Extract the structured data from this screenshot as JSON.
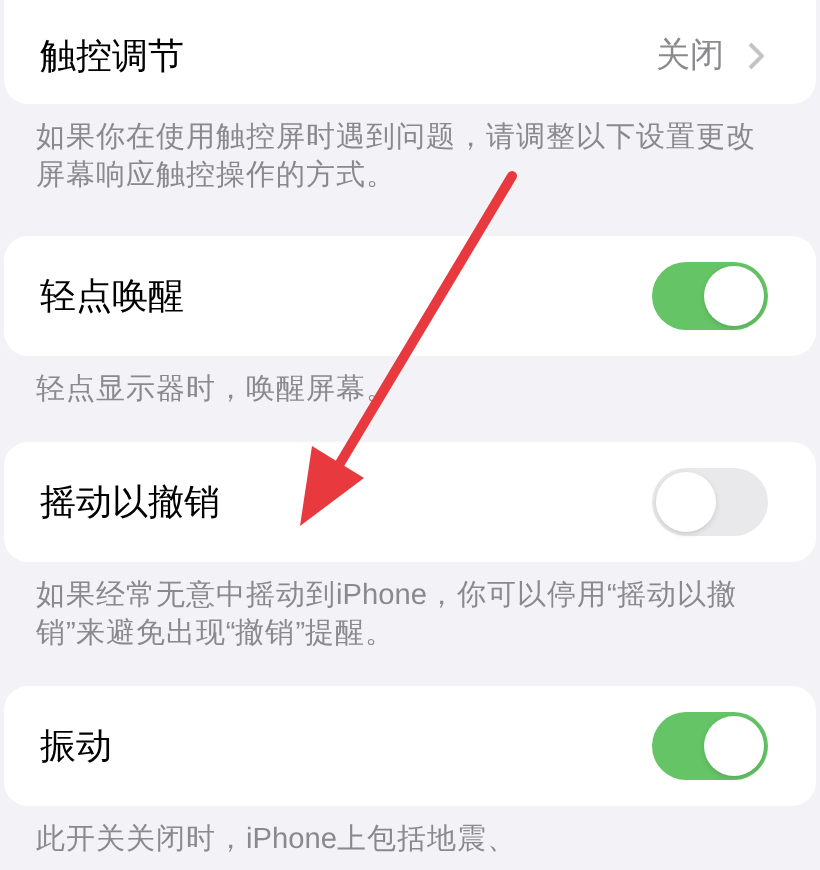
{
  "sections": [
    {
      "kind": "value",
      "label": "触控调节",
      "value": "关闭",
      "footer": "如果你在使用触控屏时遇到问题，请调整以下设置更改屏幕响应触控操作的方式。"
    },
    {
      "kind": "toggle",
      "label": "轻点唤醒",
      "on": true,
      "footer": "轻点显示器时，唤醒屏幕。"
    },
    {
      "kind": "toggle",
      "label": "摇动以撤销",
      "on": false,
      "footer": "如果经常无意中摇动到iPhone，你可以停用“摇动以撤销”来避免出现“撤销”提醒。"
    },
    {
      "kind": "toggle",
      "label": "振动",
      "on": true,
      "footer": "此开关关闭时，iPhone上包括地震、"
    }
  ]
}
